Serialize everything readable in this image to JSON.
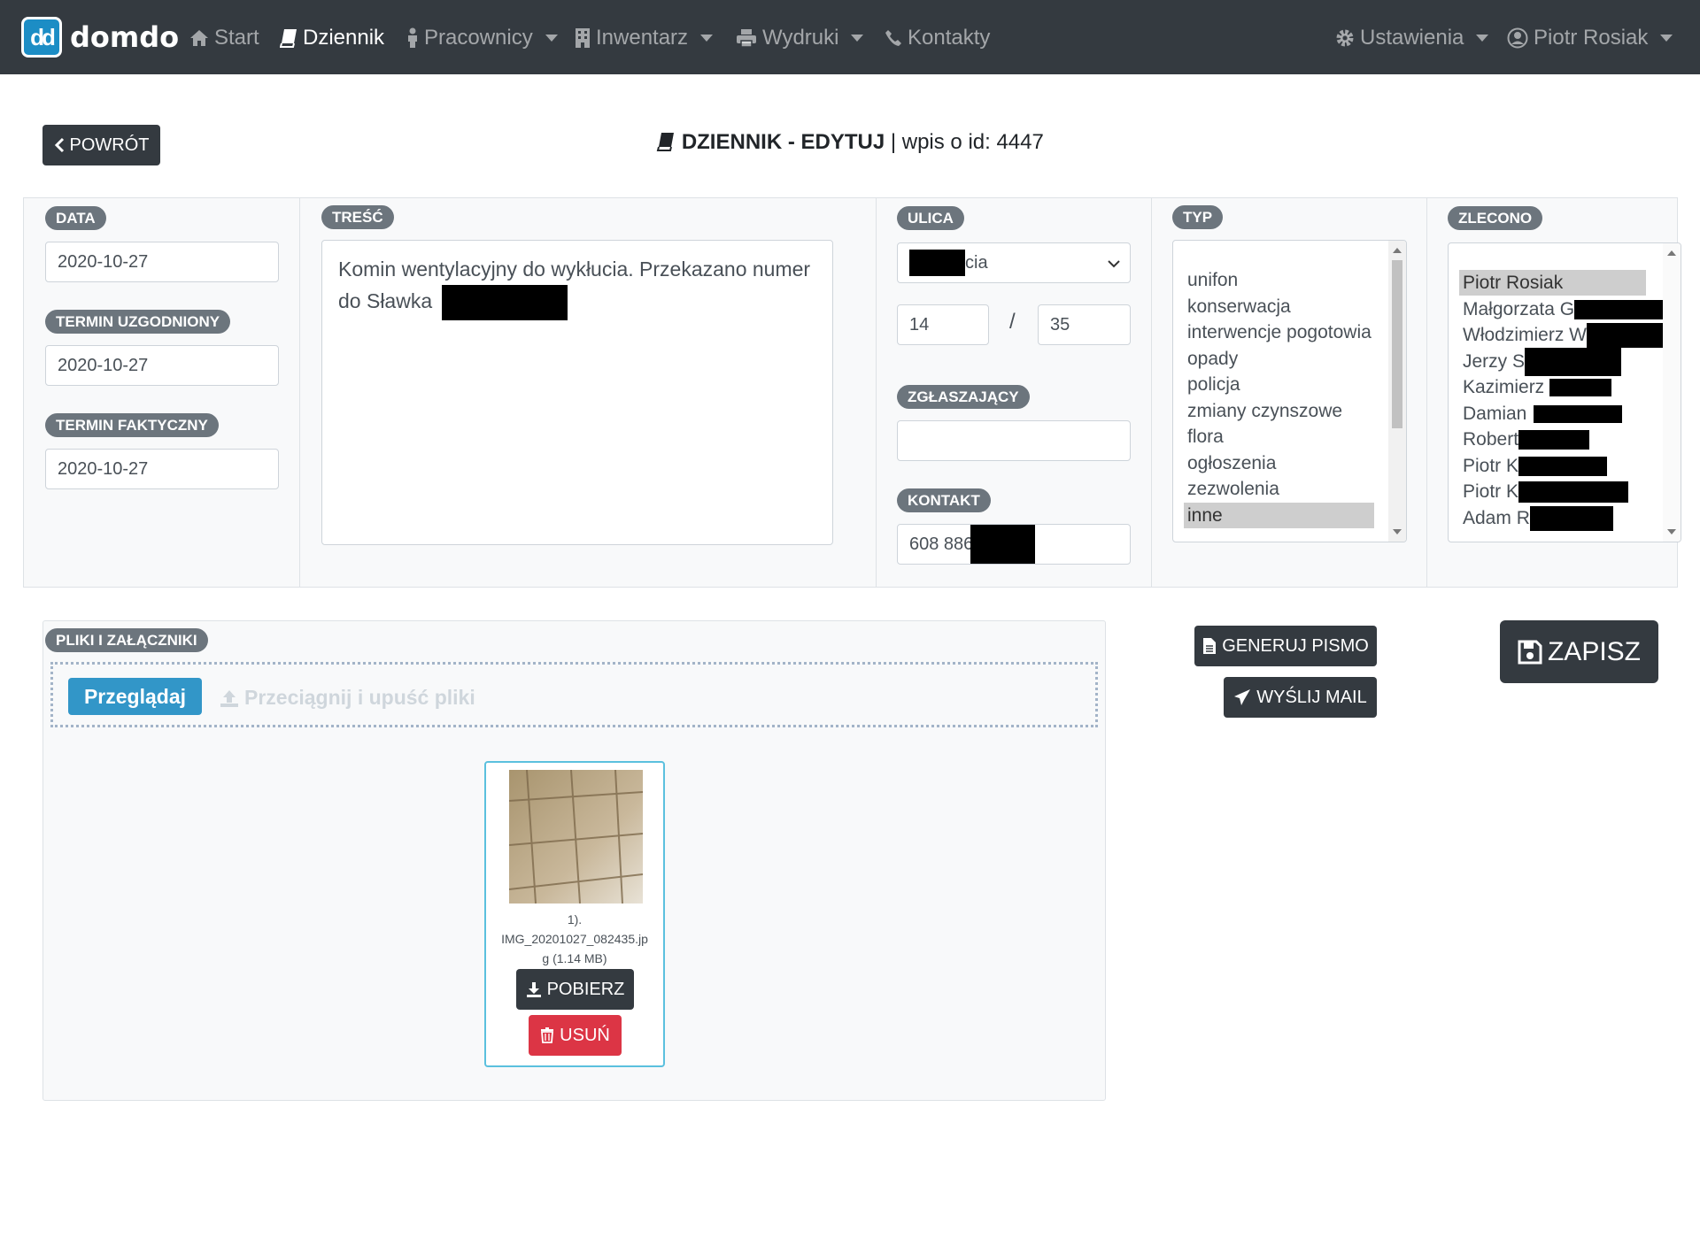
{
  "navbar": {
    "brand": "domdo",
    "brand_logo_text": "dd",
    "items": [
      {
        "label": "Start",
        "icon": "home-icon"
      },
      {
        "label": "Dziennik",
        "icon": "book-icon"
      },
      {
        "label": "Pracownicy",
        "icon": "person-icon"
      },
      {
        "label": "Inwentarz",
        "icon": "building-icon"
      },
      {
        "label": "Wydruki",
        "icon": "print-icon"
      },
      {
        "label": "Kontakty",
        "icon": "phone-icon"
      }
    ],
    "settings_label": "Ustawienia",
    "user_label": "Piotr Rosiak"
  },
  "header": {
    "back_label": "POWRÓT",
    "title_bold": "DZIENNIK - EDYTUJ",
    "title_rest": "| wpis o id: 4447"
  },
  "form": {
    "data": {
      "label": "DATA",
      "value": "2020-10-27"
    },
    "termin_uzgodniony": {
      "label": "TERMIN UZGODNIONY",
      "value": "2020-10-27"
    },
    "termin_faktyczny": {
      "label": "TERMIN FAKTYCZNY",
      "value": "2020-10-27"
    },
    "tresc": {
      "label": "TREŚĆ",
      "value": "Komin wentylacyjny do wykłucia. Przekazano numer do Sławka"
    },
    "ulica": {
      "label": "ULICA",
      "value_visible": "cia",
      "number": "14",
      "separator": "/",
      "flat": "35"
    },
    "zglaszajacy": {
      "label": "ZGŁASZAJĄCY",
      "value": ""
    },
    "kontakt": {
      "label": "KONTAKT",
      "value_visible": "608 886"
    },
    "typ": {
      "label": "TYP",
      "options": [
        "unifon",
        "konserwacja",
        "interwencje pogotowia",
        "opady",
        "policja",
        "zmiany czynszowe",
        "flora",
        "ogłoszenia",
        "zezwolenia",
        "inne"
      ],
      "selected": "inne"
    },
    "zlecono": {
      "label": "ZLECONO",
      "options": [
        "Piotr Rosiak",
        "Małgorzata G",
        "Włodzimierz W",
        "Jerzy S",
        "Kazimierz",
        "Damian",
        "Robert",
        "Piotr K",
        "Piotr K",
        "Adam R"
      ],
      "selected": "Piotr Rosiak"
    }
  },
  "files": {
    "label": "PLIKI I ZAŁĄCZNIKI",
    "browse_label": "Przeglądaj",
    "drop_hint": "Przeciągnij i upuść pliki",
    "items": [
      {
        "index": "1).",
        "name_line1": "IMG_20201027_082435.jp",
        "name_line2": "g (1.14 MB)",
        "download_label": "POBIERZ",
        "delete_label": "USUŃ"
      }
    ]
  },
  "actions": {
    "generate_label": "GENERUJ PISMO",
    "mail_label": "WYŚLIJ MAIL",
    "save_label": "ZAPISZ"
  },
  "colors": {
    "navbar": "#343a40",
    "badge": "#6c757d",
    "browse": "#3296c8",
    "danger": "#dc3545",
    "card_border": "#5bc0de"
  }
}
